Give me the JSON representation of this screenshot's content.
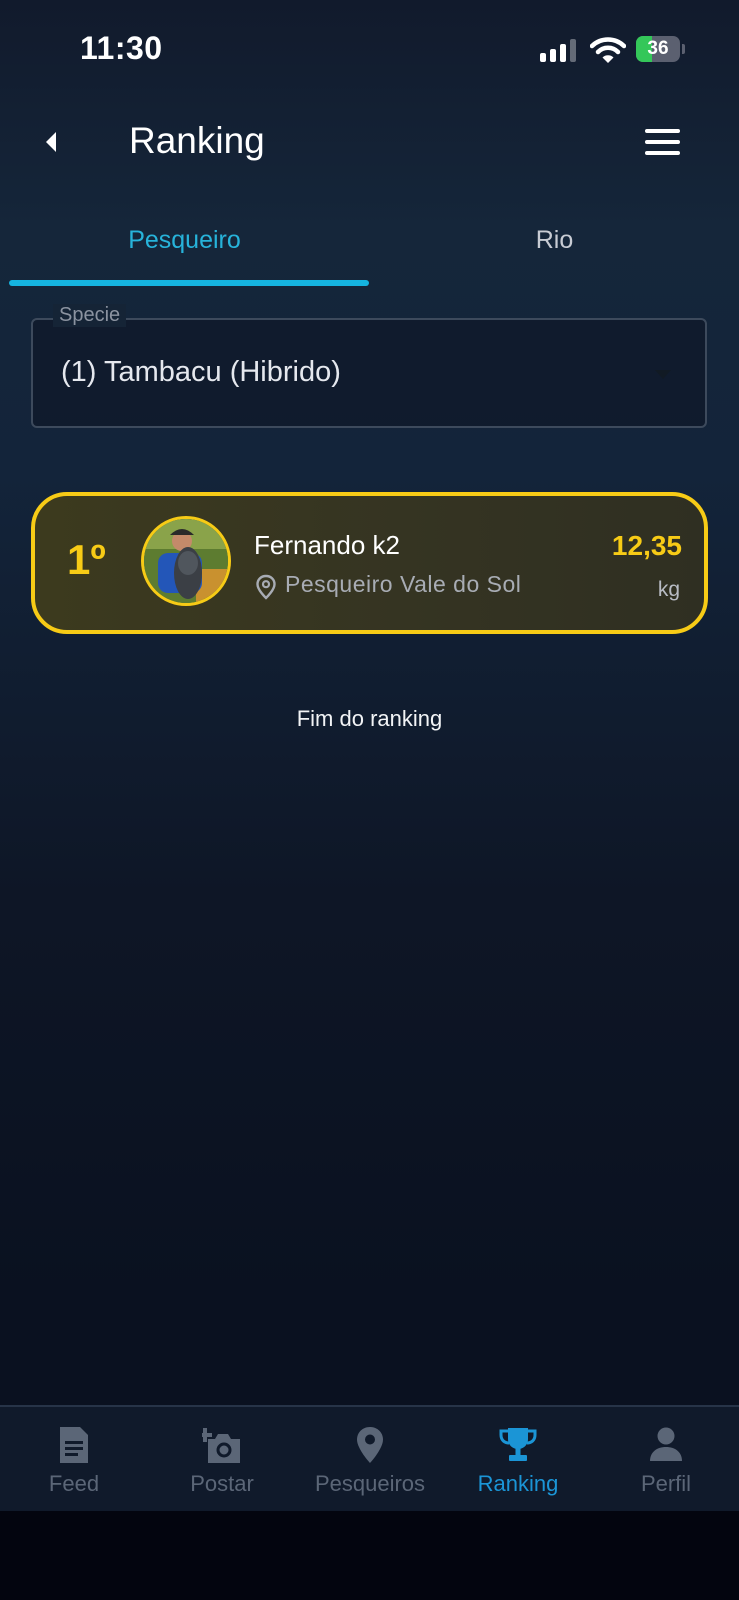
{
  "status_bar": {
    "time": "11:30",
    "battery": "36",
    "battery_level": 0.36
  },
  "header": {
    "title": "Ranking",
    "back_icon": "chevron-left-icon",
    "menu_icon": "hamburger-menu-icon"
  },
  "tabs": [
    {
      "label": "Pesqueiro",
      "active": true
    },
    {
      "label": "Rio",
      "active": false
    }
  ],
  "species_select": {
    "label": "Specie",
    "value": "(1) Tambacu (Hibrido)"
  },
  "ranking": [
    {
      "position": "1º",
      "name": "Fernando k2",
      "location": "Pesqueiro Vale do Sol",
      "weight": "12,35",
      "unit": "kg"
    }
  ],
  "end_label": "Fim do ranking",
  "bottom_nav": [
    {
      "label": "Feed",
      "icon": "document-icon",
      "active": false
    },
    {
      "label": "Postar",
      "icon": "add-photo-icon",
      "active": false
    },
    {
      "label": "Pesqueiros",
      "icon": "location-pin-icon",
      "active": false
    },
    {
      "label": "Ranking",
      "icon": "trophy-icon",
      "active": true
    },
    {
      "label": "Perfil",
      "icon": "person-icon",
      "active": false
    }
  ],
  "colors": {
    "accent": "#1b95d6",
    "gold": "#f7cb16",
    "tab_active": "#27b3da",
    "inactive": "#5b6677"
  }
}
